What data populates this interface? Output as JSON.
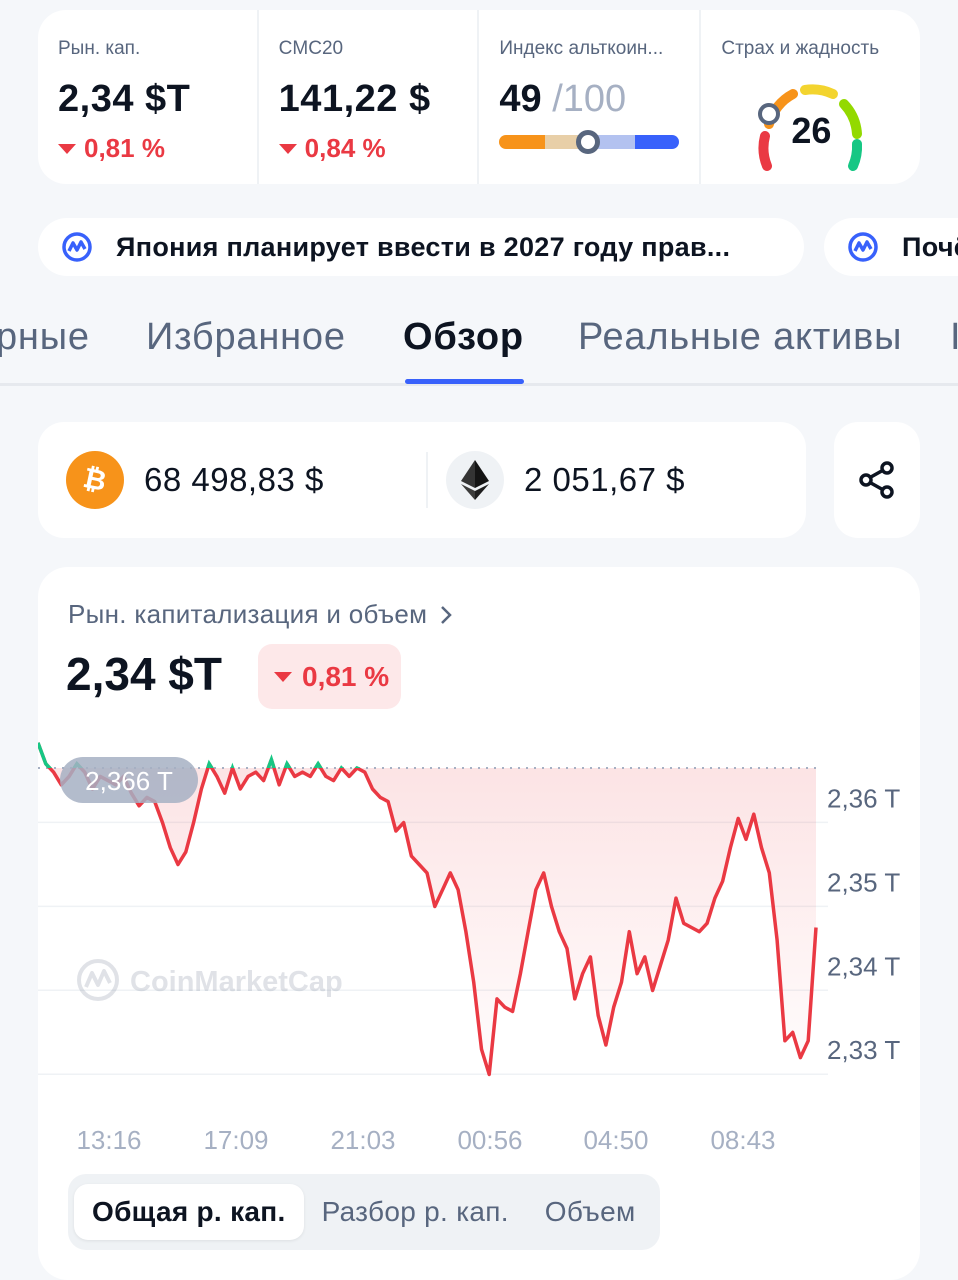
{
  "stats": {
    "market_cap": {
      "label": "Рын. кап.",
      "value": "2,34 $T",
      "change": "0,81 %",
      "direction": "down"
    },
    "cmc20": {
      "label": "CMC20",
      "value": "141,22 $",
      "change": "0,84 %",
      "direction": "down"
    },
    "altcoin_index": {
      "label": "Индекс альткоин...",
      "value": "49",
      "denominator": "/100",
      "level": 0.49
    },
    "fear_greed": {
      "label": "Страх и жадность",
      "value": "26",
      "level": 0.26
    }
  },
  "news": [
    {
      "text": "Япония планирует ввести в 2027 году прав...",
      "icon": "cmc-logo-icon"
    },
    {
      "text": "Почё",
      "icon": "cmc-logo-icon"
    }
  ],
  "tabs": [
    {
      "label": "рные",
      "active": false
    },
    {
      "label": "Избранное",
      "active": false
    },
    {
      "label": "Обзор",
      "active": true
    },
    {
      "label": "Реальные активы",
      "active": false
    },
    {
      "label": "I",
      "active": false
    }
  ],
  "prices": {
    "btc": {
      "value": "68 498,83 $",
      "icon": "bitcoin-icon"
    },
    "eth": {
      "value": "2 051,67 $",
      "icon": "ethereum-icon"
    },
    "share_icon": "share-icon"
  },
  "chart": {
    "title": "Рын. капитализация и объем",
    "value": "2,34 $T",
    "change": "0,81 %",
    "tooltip": "2,366 T",
    "watermark": "CoinMarketCap",
    "segments": [
      "Общая р. кап.",
      "Разбор р. кап.",
      "Объем"
    ],
    "active_segment": 0,
    "colors": {
      "down": "#ea3943",
      "up": "#16c784",
      "accent": "#3861fb"
    }
  },
  "chart_data": {
    "type": "area",
    "ylabel": "",
    "xlabel": "",
    "y_ticks": [
      "2,36 T",
      "2,35 T",
      "2,34 T",
      "2,33 T"
    ],
    "y_tick_values": [
      2.36,
      2.35,
      2.34,
      2.33
    ],
    "x_ticks": [
      "13:16",
      "17:09",
      "21:03",
      "00:56",
      "04:50",
      "08:43"
    ],
    "baseline": 2.3635,
    "x_range": [
      0,
      100
    ],
    "ylim": [
      2.3255,
      2.366
    ],
    "series": [
      {
        "values": [
          [
            0,
            2.3665
          ],
          [
            1,
            2.364
          ],
          [
            2,
            2.363
          ],
          [
            3,
            2.3615
          ],
          [
            4,
            2.3625
          ],
          [
            5,
            2.364
          ],
          [
            6,
            2.363
          ],
          [
            7,
            2.361
          ],
          [
            8,
            2.3625
          ],
          [
            9,
            2.362
          ],
          [
            10,
            2.3615
          ],
          [
            11,
            2.3625
          ],
          [
            12,
            2.3605
          ],
          [
            13,
            2.359
          ],
          [
            14,
            2.36
          ],
          [
            15,
            2.3595
          ],
          [
            16,
            2.357
          ],
          [
            17,
            2.354
          ],
          [
            18,
            2.352
          ],
          [
            19,
            2.3535
          ],
          [
            20,
            2.357
          ],
          [
            21,
            2.361
          ],
          [
            22,
            2.364
          ],
          [
            23,
            2.3625
          ],
          [
            24,
            2.3605
          ],
          [
            25,
            2.3635
          ],
          [
            26,
            2.361
          ],
          [
            27,
            2.3625
          ],
          [
            28,
            2.363
          ],
          [
            29,
            2.362
          ],
          [
            30,
            2.3645
          ],
          [
            31,
            2.3615
          ],
          [
            32,
            2.364
          ],
          [
            33,
            2.3625
          ],
          [
            34,
            2.363
          ],
          [
            35,
            2.3625
          ],
          [
            36,
            2.364
          ],
          [
            37,
            2.3625
          ],
          [
            38,
            2.362
          ],
          [
            39,
            2.3635
          ],
          [
            40,
            2.3625
          ],
          [
            41,
            2.3635
          ],
          [
            42,
            2.363
          ],
          [
            43,
            2.361
          ],
          [
            44,
            2.36
          ],
          [
            45,
            2.3595
          ],
          [
            46,
            2.356
          ],
          [
            47,
            2.357
          ],
          [
            48,
            2.353
          ],
          [
            49,
            2.352
          ],
          [
            50,
            2.351
          ],
          [
            51,
            2.347
          ],
          [
            52,
            2.349
          ],
          [
            53,
            2.351
          ],
          [
            54,
            2.349
          ],
          [
            55,
            2.344
          ],
          [
            56,
            2.338
          ],
          [
            57,
            2.33
          ],
          [
            58,
            2.327
          ],
          [
            59,
            2.336
          ],
          [
            60,
            2.335
          ],
          [
            61,
            2.3345
          ],
          [
            62,
            2.339
          ],
          [
            63,
            2.344
          ],
          [
            64,
            2.349
          ],
          [
            65,
            2.351
          ],
          [
            66,
            2.347
          ],
          [
            67,
            2.344
          ],
          [
            68,
            2.342
          ],
          [
            69,
            2.336
          ],
          [
            70,
            2.339
          ],
          [
            71,
            2.341
          ],
          [
            72,
            2.334
          ],
          [
            73,
            2.3305
          ],
          [
            74,
            2.335
          ],
          [
            75,
            2.338
          ],
          [
            76,
            2.344
          ],
          [
            77,
            2.339
          ],
          [
            78,
            2.341
          ],
          [
            79,
            2.337
          ],
          [
            80,
            2.34
          ],
          [
            81,
            2.343
          ],
          [
            82,
            2.348
          ],
          [
            83,
            2.345
          ],
          [
            84,
            2.3445
          ],
          [
            85,
            2.344
          ],
          [
            86,
            2.345
          ],
          [
            87,
            2.348
          ],
          [
            88,
            2.35
          ],
          [
            89,
            2.354
          ],
          [
            90,
            2.3575
          ],
          [
            91,
            2.355
          ],
          [
            92,
            2.358
          ],
          [
            93,
            2.354
          ],
          [
            94,
            2.351
          ],
          [
            95,
            2.343
          ],
          [
            96,
            2.331
          ],
          [
            97,
            2.332
          ],
          [
            98,
            2.329
          ],
          [
            99,
            2.331
          ],
          [
            100,
            2.3445
          ]
        ]
      }
    ]
  }
}
